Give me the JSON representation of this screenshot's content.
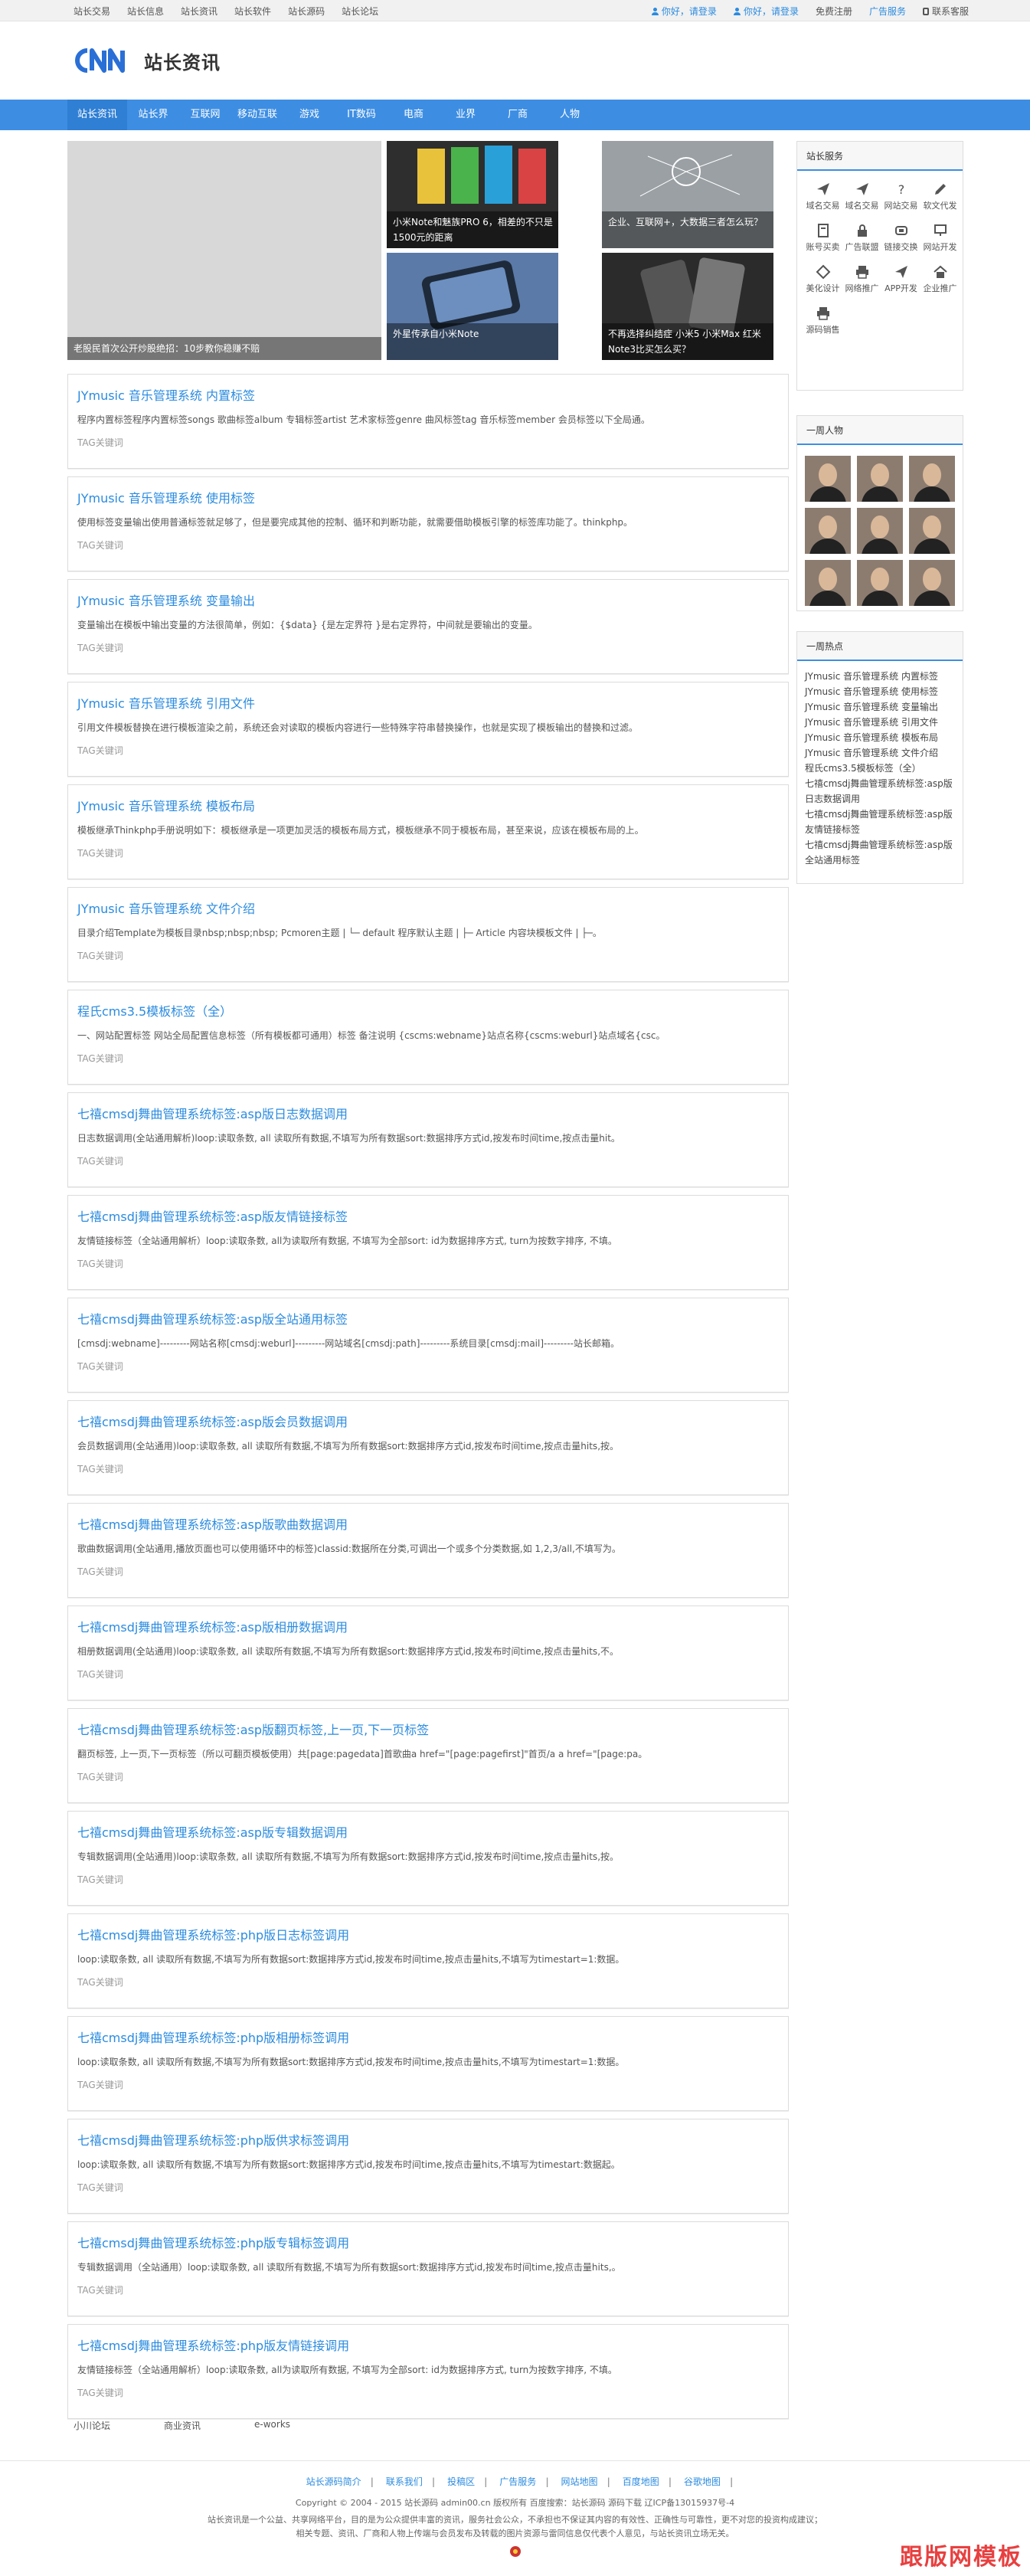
{
  "topbar": {
    "left": [
      "站长交易",
      "站长信息",
      "站长资讯",
      "站长软件",
      "站长源码",
      "站长论坛"
    ],
    "login1": "你好，请登录",
    "login2": "你好，请登录",
    "register": "免费注册",
    "ad": "广告服务",
    "contact": "联系客服"
  },
  "header": {
    "logo_text": "站长资讯"
  },
  "nav": [
    "站长资讯",
    "站长界",
    "互联网",
    "移动互联",
    "游戏",
    "IT数码",
    "电商",
    "业界",
    "厂商",
    "人物"
  ],
  "slider": {
    "big_caption": "老股民首次公开炒股绝招：10步教你稳赚不赔",
    "thumbs": [
      "小米Note和魅族PRO 6，相差的不只是1500元的距离",
      "企业、互联网+，大数据三者怎么玩？",
      "外星传承自小米Note",
      "不再选择纠结症 小米5 小米Max 红米Note3比买怎么买？"
    ]
  },
  "tag_label": "TAG关键词",
  "articles": [
    {
      "title": "JYmusic 音乐管理系统 内置标签",
      "desc": "程序内置标签程序内置标签songs 歌曲标签album 专辑标签artist 艺术家标签genre 曲风标签tag 音乐标签member 会员标签以下全局通。"
    },
    {
      "title": "JYmusic 音乐管理系统 使用标签",
      "desc": "使用标签变量输出使用普通标签就足够了，但是要完成其他的控制、循环和判断功能，就需要借助模板引擎的标签库功能了。thinkphp。"
    },
    {
      "title": "JYmusic 音乐管理系统 变量输出",
      "desc": "变量输出在模板中输出变量的方法很简单，例如：{$data} {是左定界符 }是右定界符，中间就是要输出的变量。"
    },
    {
      "title": "JYmusic 音乐管理系统 引用文件",
      "desc": "引用文件模板替换在进行模板渲染之前，系统还会对读取的模板内容进行一些特殊字符串替换操作，也就是实现了模板输出的替换和过滤。"
    },
    {
      "title": "JYmusic 音乐管理系统 模板布局",
      "desc": "模板继承Thinkphp手册说明如下：模板继承是一项更加灵活的模板布局方式，模板继承不同于模板布局，甚至来说，应该在模板布局的上。"
    },
    {
      "title": "JYmusic 音乐管理系统 文件介绍",
      "desc": "目录介绍Template为模板目录nbsp;nbsp;nbsp; Pcmoren主题 | └─ default 程序默认主题 | ├─ Article 内容块模板文件 | ├─。"
    },
    {
      "title": "程氏cms3.5模板标签（全）",
      "desc": "一、网站配置标签 网站全局配置信息标签（所有模板都可通用）标签 备注说明 {cscms:webname}站点名称{cscms:weburl}站点域名{csc。"
    },
    {
      "title": "七禧cmsdj舞曲管理系统标签:asp版日志数据调用",
      "desc": "日志数据调用(全站通用解析)loop:读取条数, all 读取所有数据,不填写为所有数据sort:数据排序方式id,按发布时间time,按点击量hit。"
    },
    {
      "title": "七禧cmsdj舞曲管理系统标签:asp版友情链接标签",
      "desc": "友情链接标签（全站通用解析）loop:读取条数, all为读取所有数据, 不填写为全部sort: id为数据排序方式, turn为按数字排序, 不填。"
    },
    {
      "title": "七禧cmsdj舞曲管理系统标签:asp版全站通用标签",
      "desc": "[cmsdj:webname]---------网站名称[cmsdj:weburl]---------网站域名[cmsdj:path]---------系统目录[cmsdj:mail]---------站长邮箱。"
    },
    {
      "title": "七禧cmsdj舞曲管理系统标签:asp版会员数据调用",
      "desc": "会员数据调用(全站通用)loop:读取条数, all 读取所有数据,不填写为所有数据sort:数据排序方式id,按发布时间time,按点击量hits,按。"
    },
    {
      "title": "七禧cmsdj舞曲管理系统标签:asp版歌曲数据调用",
      "desc": "歌曲数据调用(全站通用,播放页面也可以使用循环中的标签)classid:数据所在分类,可调出一个或多个分类数据,如 1,2,3/all,不填写为。"
    },
    {
      "title": "七禧cmsdj舞曲管理系统标签:asp版相册数据调用",
      "desc": "相册数据调用(全站通用)loop:读取条数, all 读取所有数据,不填写为所有数据sort:数据排序方式id,按发布时间time,按点击量hits,不。"
    },
    {
      "title": "七禧cmsdj舞曲管理系统标签:asp版翻页标签,上一页,下一页标签",
      "desc": "翻页标签, 上一页,下一页标签（所以可翻页模板使用）共[page:pagedata]首歌曲a href=\"[page:pagefirst]\"首页/a a href=\"[page:pa。"
    },
    {
      "title": "七禧cmsdj舞曲管理系统标签:asp版专辑数据调用",
      "desc": "专辑数据调用(全站通用)loop:读取条数, all 读取所有数据,不填写为所有数据sort:数据排序方式id,按发布时间time,按点击量hits,按。"
    },
    {
      "title": "七禧cmsdj舞曲管理系统标签:php版日志标签调用",
      "desc": "loop:读取条数, all 读取所有数据,不填写为所有数据sort:数据排序方式id,按发布时间time,按点击量hits,不填写为timestart=1:数据。"
    },
    {
      "title": "七禧cmsdj舞曲管理系统标签:php版相册标签调用",
      "desc": "loop:读取条数, all 读取所有数据,不填写为所有数据sort:数据排序方式id,按发布时间time,按点击量hits,不填写为timestart=1:数据。"
    },
    {
      "title": "七禧cmsdj舞曲管理系统标签:php版供求标签调用",
      "desc": "loop:读取条数, all 读取所有数据,不填写为所有数据sort:数据排序方式id,按发布时间time,按点击量hits,不填写为timestart:数据起。"
    },
    {
      "title": "七禧cmsdj舞曲管理系统标签:php版专辑标签调用",
      "desc": "专辑数据调用（全站通用）loop:读取条数, all 读取所有数据,不填写为所有数据sort:数据排序方式id,按发布时间time,按点击量hits,。"
    },
    {
      "title": "七禧cmsdj舞曲管理系统标签:php版友情链接调用",
      "desc": "友情链接标签（全站通用解析）loop:读取条数, all为读取所有数据, 不填写为全部sort: id为数据排序方式, turn为按数字排序, 不填。"
    }
  ],
  "sidebar": {
    "services_title": "站长服务",
    "services": [
      {
        "label": "域名交易",
        "icon": "send-icon"
      },
      {
        "label": "域名交易",
        "icon": "send-icon"
      },
      {
        "label": "网站交易",
        "icon": "question-icon"
      },
      {
        "label": "软文代发",
        "icon": "edit-icon"
      },
      {
        "label": "账号买卖",
        "icon": "document-icon"
      },
      {
        "label": "广告联盟",
        "icon": "lock-icon"
      },
      {
        "label": "链接交换",
        "icon": "link-icon"
      },
      {
        "label": "网站开发",
        "icon": "monitor-icon"
      },
      {
        "label": "美化设计",
        "icon": "brush-icon"
      },
      {
        "label": "网络推广",
        "icon": "print-icon"
      },
      {
        "label": "APP开发",
        "icon": "send-icon"
      },
      {
        "label": "企业推广",
        "icon": "home-icon"
      },
      {
        "label": "源码销售",
        "icon": "print-icon"
      }
    ],
    "people_title": "一周人物",
    "hot_title": "一周热点",
    "hot": [
      "JYmusic 音乐管理系统 内置标签",
      "JYmusic 音乐管理系统 使用标签",
      "JYmusic 音乐管理系统 变量输出",
      "JYmusic 音乐管理系统 引用文件",
      "JYmusic 音乐管理系统 模板布局",
      "JYmusic 音乐管理系统 文件介绍",
      "程氏cms3.5模板标签（全）",
      "七禧cmsdj舞曲管理系统标签:asp版日志数据调用",
      "七禧cmsdj舞曲管理系统标签:asp版友情链接标签",
      "七禧cmsdj舞曲管理系统标签:asp版全站通用标签"
    ]
  },
  "friend_links": [
    "小川论坛",
    "商业资讯",
    "e-works"
  ],
  "footer": {
    "nav": [
      "站长源码简介",
      "联系我们",
      "投稿区",
      "广告服务",
      "网站地图",
      "百度地图",
      "谷歌地图"
    ],
    "copyright": "Copyright © 2004 - 2015 站长源码 admin00.cn 版权所有 百度搜索：站长源码 源码下载 辽ICP备13015937号-4",
    "line2": "站长资讯是一个公益、共享网络平台，目的是为公众提供丰富的资讯，服务社会公众，不承担也不保证其内容的有效性、正确性与可靠性，更不对您的投资构成建议；",
    "line3": "相关专题、资讯、厂商和人物上传端与会员发布及转载的图片资源与雷同信息仅代表个人意见，与站长资讯立场无关。",
    "watermark": "跟版网模板"
  }
}
